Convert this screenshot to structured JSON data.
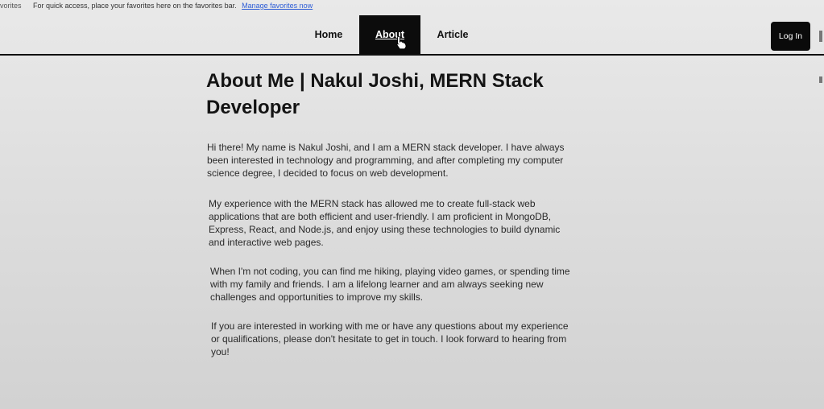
{
  "favorites_bar": {
    "left_label": "vorites",
    "message": "For quick access, place your favorites here on the favorites bar.",
    "manage_link": "Manage favorites now"
  },
  "nav": {
    "items": [
      {
        "label": "Home",
        "active": false
      },
      {
        "label": "About",
        "active": true
      },
      {
        "label": "Article",
        "active": false
      }
    ],
    "login_label": "Log In"
  },
  "main": {
    "title": "About Me | Nakul Joshi, MERN Stack Developer",
    "paragraphs": [
      "Hi there! My name is Nakul Joshi, and I am a MERN stack developer. I have always been interested in technology and programming, and after completing my computer science degree, I decided to focus on web development.",
      "My experience with the MERN stack has allowed me to create full-stack web applications that are both efficient and user-friendly. I am proficient in MongoDB, Express, React, and Node.js, and enjoy using these technologies to build dynamic and interactive web pages.",
      "When I'm not coding, you can find me hiking, playing video games, or spending time with my family and friends. I am a lifelong learner and am always seeking new challenges and opportunities to improve my skills.",
      "If you are interested in working with me or have any questions about my experience or qualifications, please don't hesitate to get in touch. I look forward to hearing from you!"
    ]
  },
  "icons": {
    "cursor": "hand-pointer-icon"
  },
  "colors": {
    "nav_active_bg": "#0c0c0c",
    "login_bg": "#0a0a0a",
    "link": "#2b5bd6"
  }
}
